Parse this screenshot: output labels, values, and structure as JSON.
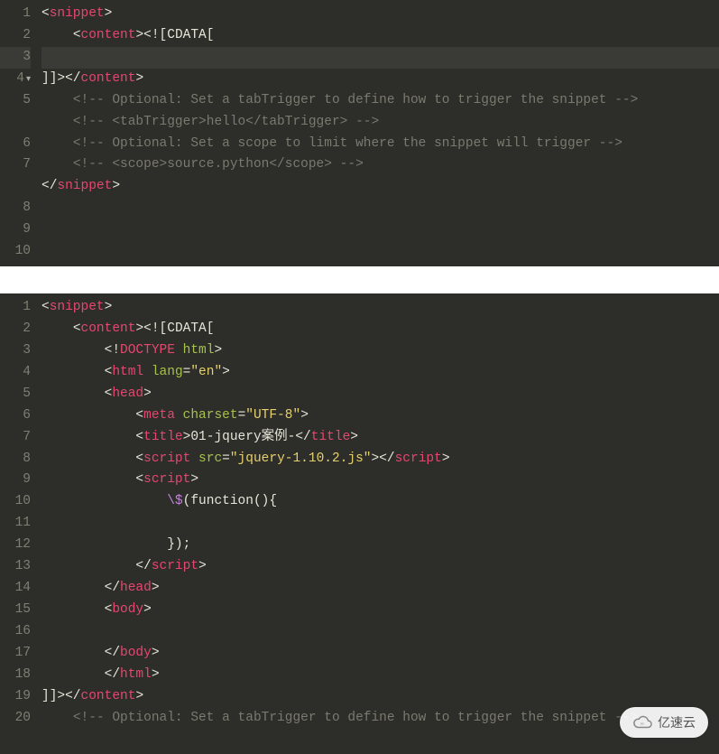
{
  "editors": [
    {
      "active_line": 3,
      "fold_line": 4,
      "lines": [
        {
          "n": 1,
          "tokens": [
            [
              "punct",
              "<"
            ],
            [
              "tag",
              "snippet"
            ],
            [
              "punct",
              ">"
            ]
          ]
        },
        {
          "n": 2,
          "tokens": [
            [
              "txt",
              "    "
            ],
            [
              "punct",
              "<"
            ],
            [
              "tag",
              "content"
            ],
            [
              "punct",
              ">"
            ],
            [
              "cdata",
              "<![CDATA["
            ]
          ]
        },
        {
          "n": 3,
          "tokens": []
        },
        {
          "n": 4,
          "tokens": [
            [
              "cdata",
              "]]>"
            ],
            [
              "punct",
              "</"
            ],
            [
              "tag",
              "content"
            ],
            [
              "punct",
              ">"
            ]
          ]
        },
        {
          "n": 5,
          "tokens": [
            [
              "txt",
              "    "
            ],
            [
              "comment",
              "<!-- Optional: Set a tabTrigger to define how to trigger the snippet -->"
            ]
          ],
          "wrap": true
        },
        {
          "n": 6,
          "tokens": [
            [
              "txt",
              "    "
            ],
            [
              "comment",
              "<!-- <tabTrigger>hello</tabTrigger> -->"
            ]
          ]
        },
        {
          "n": 7,
          "tokens": [
            [
              "txt",
              "    "
            ],
            [
              "comment",
              "<!-- Optional: Set a scope to limit where the snippet will trigger -->"
            ]
          ],
          "wrap": true
        },
        {
          "n": 8,
          "tokens": [
            [
              "txt",
              "    "
            ],
            [
              "comment",
              "<!-- <scope>source.python</scope> -->"
            ]
          ]
        },
        {
          "n": 9,
          "tokens": [
            [
              "punct",
              "</"
            ],
            [
              "tag",
              "snippet"
            ],
            [
              "punct",
              ">"
            ]
          ]
        },
        {
          "n": 10,
          "tokens": []
        }
      ]
    },
    {
      "active_line": null,
      "fold_line": null,
      "lines": [
        {
          "n": 1,
          "tokens": [
            [
              "punct",
              "<"
            ],
            [
              "tag",
              "snippet"
            ],
            [
              "punct",
              ">"
            ]
          ]
        },
        {
          "n": 2,
          "tokens": [
            [
              "txt",
              "    "
            ],
            [
              "punct",
              "<"
            ],
            [
              "tag",
              "content"
            ],
            [
              "punct",
              ">"
            ],
            [
              "cdata",
              "<![CDATA["
            ]
          ]
        },
        {
          "n": 3,
          "tokens": [
            [
              "txt",
              "        "
            ],
            [
              "punct",
              "<!"
            ],
            [
              "tag",
              "DOCTYPE"
            ],
            [
              "txt",
              " "
            ],
            [
              "attr-name",
              "html"
            ],
            [
              "punct",
              ">"
            ]
          ]
        },
        {
          "n": 4,
          "tokens": [
            [
              "txt",
              "        "
            ],
            [
              "punct",
              "<"
            ],
            [
              "tag",
              "html"
            ],
            [
              "txt",
              " "
            ],
            [
              "attr-name",
              "lang"
            ],
            [
              "punct",
              "="
            ],
            [
              "attr-val",
              "\"en\""
            ],
            [
              "punct",
              ">"
            ]
          ]
        },
        {
          "n": 5,
          "tokens": [
            [
              "txt",
              "        "
            ],
            [
              "punct",
              "<"
            ],
            [
              "tag",
              "head"
            ],
            [
              "punct",
              ">"
            ]
          ]
        },
        {
          "n": 6,
          "tokens": [
            [
              "txt",
              "            "
            ],
            [
              "punct",
              "<"
            ],
            [
              "tag",
              "meta"
            ],
            [
              "txt",
              " "
            ],
            [
              "attr-name",
              "charset"
            ],
            [
              "punct",
              "="
            ],
            [
              "attr-val",
              "\"UTF-8\""
            ],
            [
              "punct",
              ">"
            ]
          ]
        },
        {
          "n": 7,
          "tokens": [
            [
              "txt",
              "            "
            ],
            [
              "punct",
              "<"
            ],
            [
              "tag",
              "title"
            ],
            [
              "punct",
              ">"
            ],
            [
              "txt",
              "01-jquery案例-"
            ],
            [
              "punct",
              "</"
            ],
            [
              "tag",
              "title"
            ],
            [
              "punct",
              ">"
            ]
          ]
        },
        {
          "n": 8,
          "tokens": [
            [
              "txt",
              "            "
            ],
            [
              "punct",
              "<"
            ],
            [
              "tag",
              "script"
            ],
            [
              "txt",
              " "
            ],
            [
              "attr-name",
              "src"
            ],
            [
              "punct",
              "="
            ],
            [
              "attr-val",
              "\"jquery-1.10.2.js\""
            ],
            [
              "punct",
              ">"
            ],
            [
              "punct",
              "</"
            ],
            [
              "tag",
              "script"
            ],
            [
              "punct",
              ">"
            ]
          ]
        },
        {
          "n": 9,
          "tokens": [
            [
              "txt",
              "            "
            ],
            [
              "punct",
              "<"
            ],
            [
              "tag",
              "script"
            ],
            [
              "punct",
              ">"
            ]
          ]
        },
        {
          "n": 10,
          "tokens": [
            [
              "txt",
              "                "
            ],
            [
              "esc",
              "\\$"
            ],
            [
              "txt",
              "(function(){"
            ]
          ]
        },
        {
          "n": 11,
          "tokens": []
        },
        {
          "n": 12,
          "tokens": [
            [
              "txt",
              "                });"
            ]
          ]
        },
        {
          "n": 13,
          "tokens": [
            [
              "txt",
              "            "
            ],
            [
              "punct",
              "</"
            ],
            [
              "tag",
              "script"
            ],
            [
              "punct",
              ">"
            ]
          ]
        },
        {
          "n": 14,
          "tokens": [
            [
              "txt",
              "        "
            ],
            [
              "punct",
              "</"
            ],
            [
              "tag",
              "head"
            ],
            [
              "punct",
              ">"
            ]
          ]
        },
        {
          "n": 15,
          "tokens": [
            [
              "txt",
              "        "
            ],
            [
              "punct",
              "<"
            ],
            [
              "tag",
              "body"
            ],
            [
              "punct",
              ">"
            ]
          ]
        },
        {
          "n": 16,
          "tokens": []
        },
        {
          "n": 17,
          "tokens": [
            [
              "txt",
              "        "
            ],
            [
              "punct",
              "</"
            ],
            [
              "tag",
              "body"
            ],
            [
              "punct",
              ">"
            ]
          ]
        },
        {
          "n": 18,
          "tokens": [
            [
              "txt",
              "        "
            ],
            [
              "punct",
              "</"
            ],
            [
              "tag",
              "html"
            ],
            [
              "punct",
              ">"
            ]
          ]
        },
        {
          "n": 19,
          "tokens": [
            [
              "cdata",
              "]]>"
            ],
            [
              "punct",
              "</"
            ],
            [
              "tag",
              "content"
            ],
            [
              "punct",
              ">"
            ]
          ]
        },
        {
          "n": 20,
          "tokens": [
            [
              "txt",
              "    "
            ],
            [
              "comment",
              "<!-- Optional: Set a tabTrigger to define how to trigger the snippet -->"
            ]
          ],
          "wrap": true
        }
      ]
    }
  ],
  "watermark": "亿速云"
}
